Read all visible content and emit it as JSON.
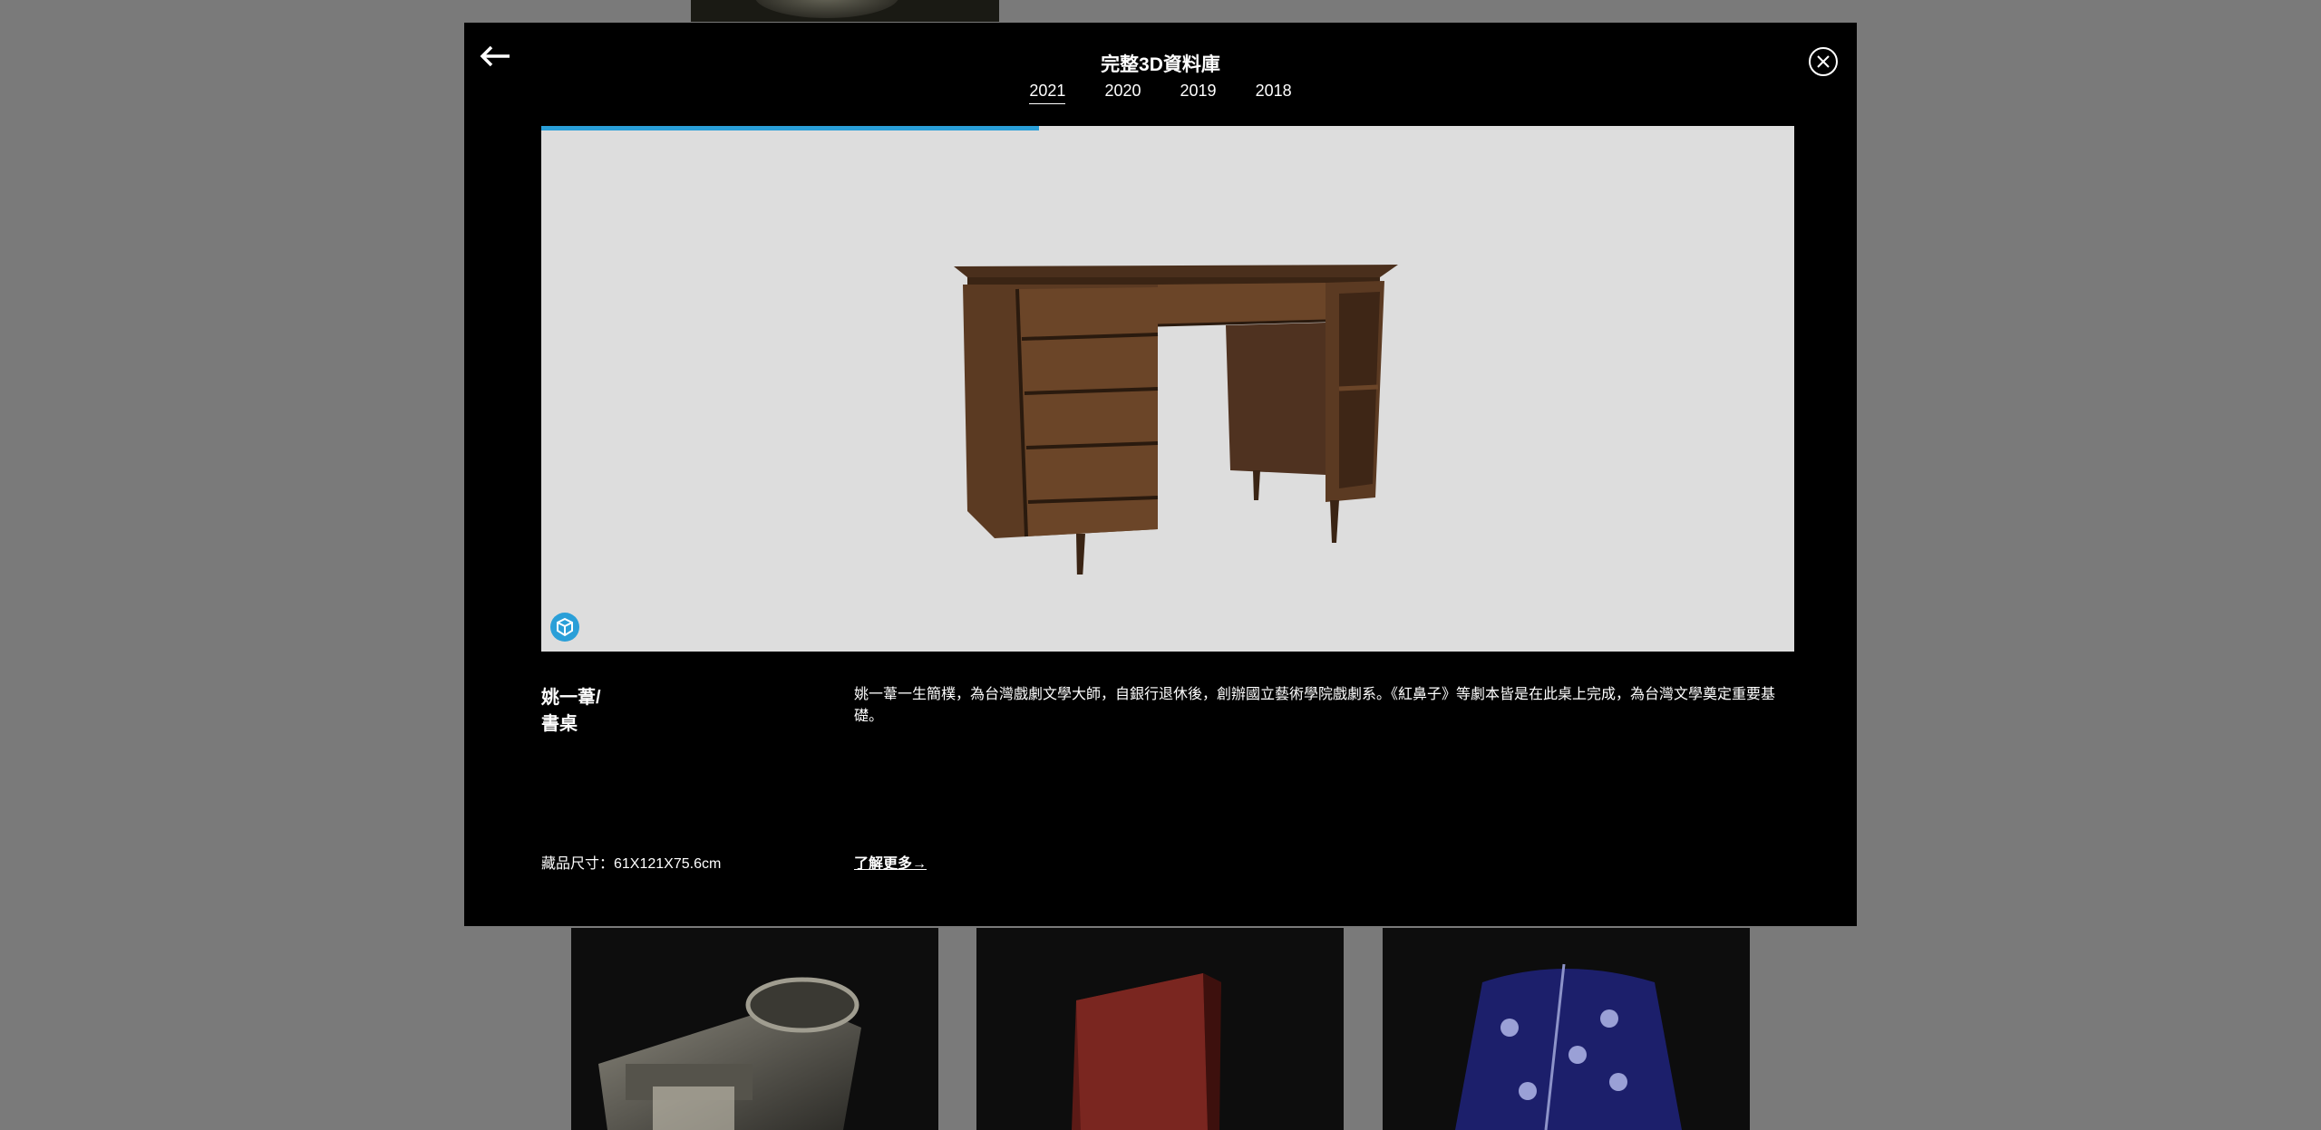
{
  "modal": {
    "title": "完整3D資料庫",
    "tabs": [
      {
        "label": "2021",
        "active": true
      },
      {
        "label": "2020"
      },
      {
        "label": "2019"
      },
      {
        "label": "2018"
      }
    ]
  },
  "viewer": {
    "load_progress": 0.397,
    "accent_color": "#2a9fd8",
    "badge_icon": "3d-model-icon"
  },
  "item": {
    "name_line1": "姚一葦/",
    "name_line2": "書桌",
    "description": "姚一葦一生簡樸，為台灣戲劇文學大師，自銀行退休後，創辦國立藝術學院戲劇系。《紅鼻子》等劇本皆是在此桌上完成，為台灣文學奠定重要基礎。",
    "size": "藏品尺寸：61X121X75.6cm",
    "learn_more": "了解更多→"
  }
}
